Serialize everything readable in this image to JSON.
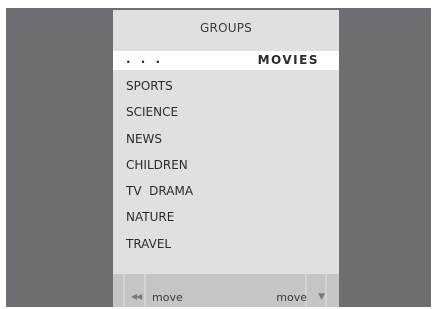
{
  "menu": {
    "title": "GROUPS",
    "selected": {
      "prefix": ". . .",
      "label": "MOVIES"
    },
    "items": [
      "SPORTS",
      "SCIENCE",
      "NEWS",
      "CHILDREN",
      "TV  DRAMA",
      "NATURE",
      "TRAVEL"
    ]
  },
  "footer": {
    "left_icon": "rewind-icon",
    "left_label": "move",
    "right_label": "move",
    "right_icon": "down-arrow-icon"
  },
  "colors": {
    "outer_frame": "#6d6e71",
    "panel": "#dfe0e1",
    "highlight": "#ffffff",
    "footer": "#c4c5c7",
    "text": "#2b2b2d"
  }
}
